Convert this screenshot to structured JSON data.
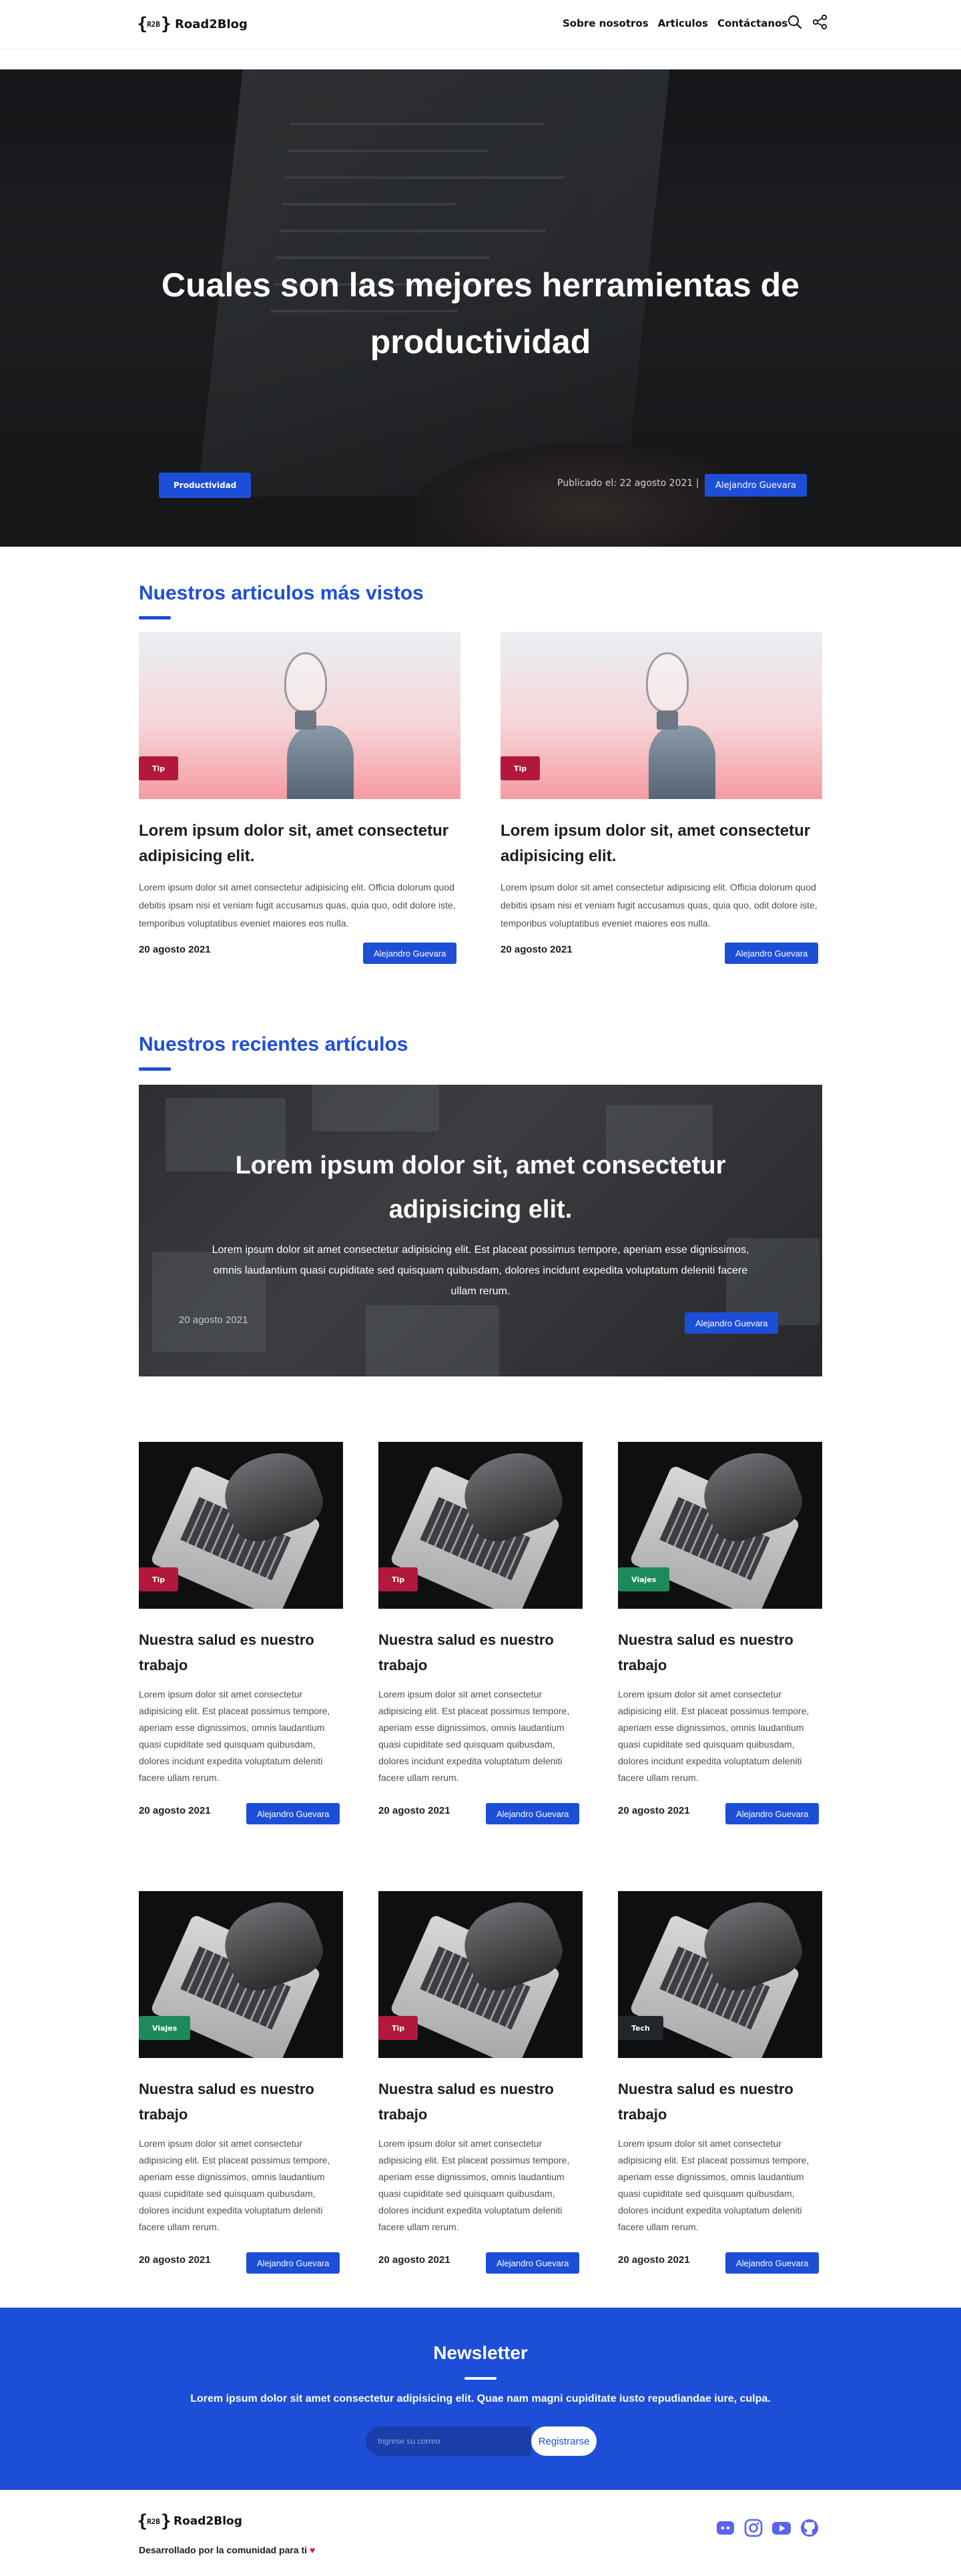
{
  "header": {
    "brand": "Road2Blog",
    "nav": [
      "Sobre nosotros",
      "Articulos",
      "Contáctanos"
    ],
    "icons": [
      "search-icon",
      "share-icon"
    ]
  },
  "hero": {
    "title": "Cuales son las mejores herramientas de productividad",
    "tag": "Productividad",
    "published": "Publicado el: 22 agosto 2021 |",
    "author": "Alejandro Guevara"
  },
  "most_viewed": {
    "title": "Nuestros articulos más vistos",
    "cards": [
      {
        "tag": "Tip",
        "title": "Lorem ipsum dolor sit, amet consectetur adipisicing elit.",
        "text": "Lorem ipsum dolor sit amet consectetur adipisicing elit. Officia dolorum quod debitis ipsam nisi et veniam fugit accusamus quas, quia quo, odit dolore iste, temporibus voluptatibus eveniet maiores eos nulla.",
        "date": "20 agosto 2021",
        "author": "Alejandro Guevara"
      },
      {
        "tag": "Tip",
        "title": "Lorem ipsum dolor sit, amet consectetur adipisicing elit.",
        "text": "Lorem ipsum dolor sit amet consectetur adipisicing elit. Officia dolorum quod debitis ipsam nisi et veniam fugit accusamus quas, quia quo, odit dolore iste, temporibus voluptatibus eveniet maiores eos nulla.",
        "date": "20 agosto 2021",
        "author": "Alejandro Guevara"
      }
    ]
  },
  "recent": {
    "title": "Nuestros recientes artículos",
    "featured": {
      "title": "Lorem ipsum dolor sit, amet consectetur adipisicing elit.",
      "text": "Lorem ipsum dolor sit amet consectetur adipisicing elit. Est placeat possimus tempore, aperiam esse dignissimos, omnis laudantium quasi cupiditate sed quisquam quibusdam, dolores incidunt expedita voluptatum deleniti facere ullam rerum.",
      "date": "20 agosto 2021",
      "author": "Alejandro Guevara"
    },
    "cards": [
      {
        "tag": "Tip",
        "tag_type": "tip"
      },
      {
        "tag": "Tip",
        "tag_type": "tip"
      },
      {
        "tag": "Viajes",
        "tag_type": "viajes"
      },
      {
        "tag": "Viajes",
        "tag_type": "viajes"
      },
      {
        "tag": "Tip",
        "tag_type": "tip"
      },
      {
        "tag": "Tech",
        "tag_type": "tech"
      }
    ],
    "card_title": "Nuestra salud es nuestro trabajo",
    "card_text": "Lorem ipsum dolor sit amet consectetur adipisicing elit. Est placeat possimus tempore, aperiam esse dignissimos, omnis laudantium quasi cupiditate sed quisquam quibusdam, dolores incidunt expedita voluptatum deleniti facere ullam rerum.",
    "card_date": "20 agosto 2021",
    "card_author": "Alejandro Guevara"
  },
  "newsletter": {
    "title": "Newsletter",
    "text": "Lorem ipsum dolor sit amet consectetur adipisicing elit. Quae nam magni cupiditate iusto repudiandae iure, culpa.",
    "placeholder": "Ingrese su correo",
    "button": "Registrarse"
  },
  "footer": {
    "brand": "Road2Blog",
    "dev_text": "Desarrollado por la comunidad para ti",
    "heart": "♥",
    "socials": [
      "discord-icon",
      "instagram-icon",
      "youtube-icon",
      "github-icon"
    ]
  },
  "colors": {
    "primary": "#1d4ed8",
    "tip": "#b2183c",
    "viajes": "#1e8a5a",
    "tech": "#22262b"
  }
}
